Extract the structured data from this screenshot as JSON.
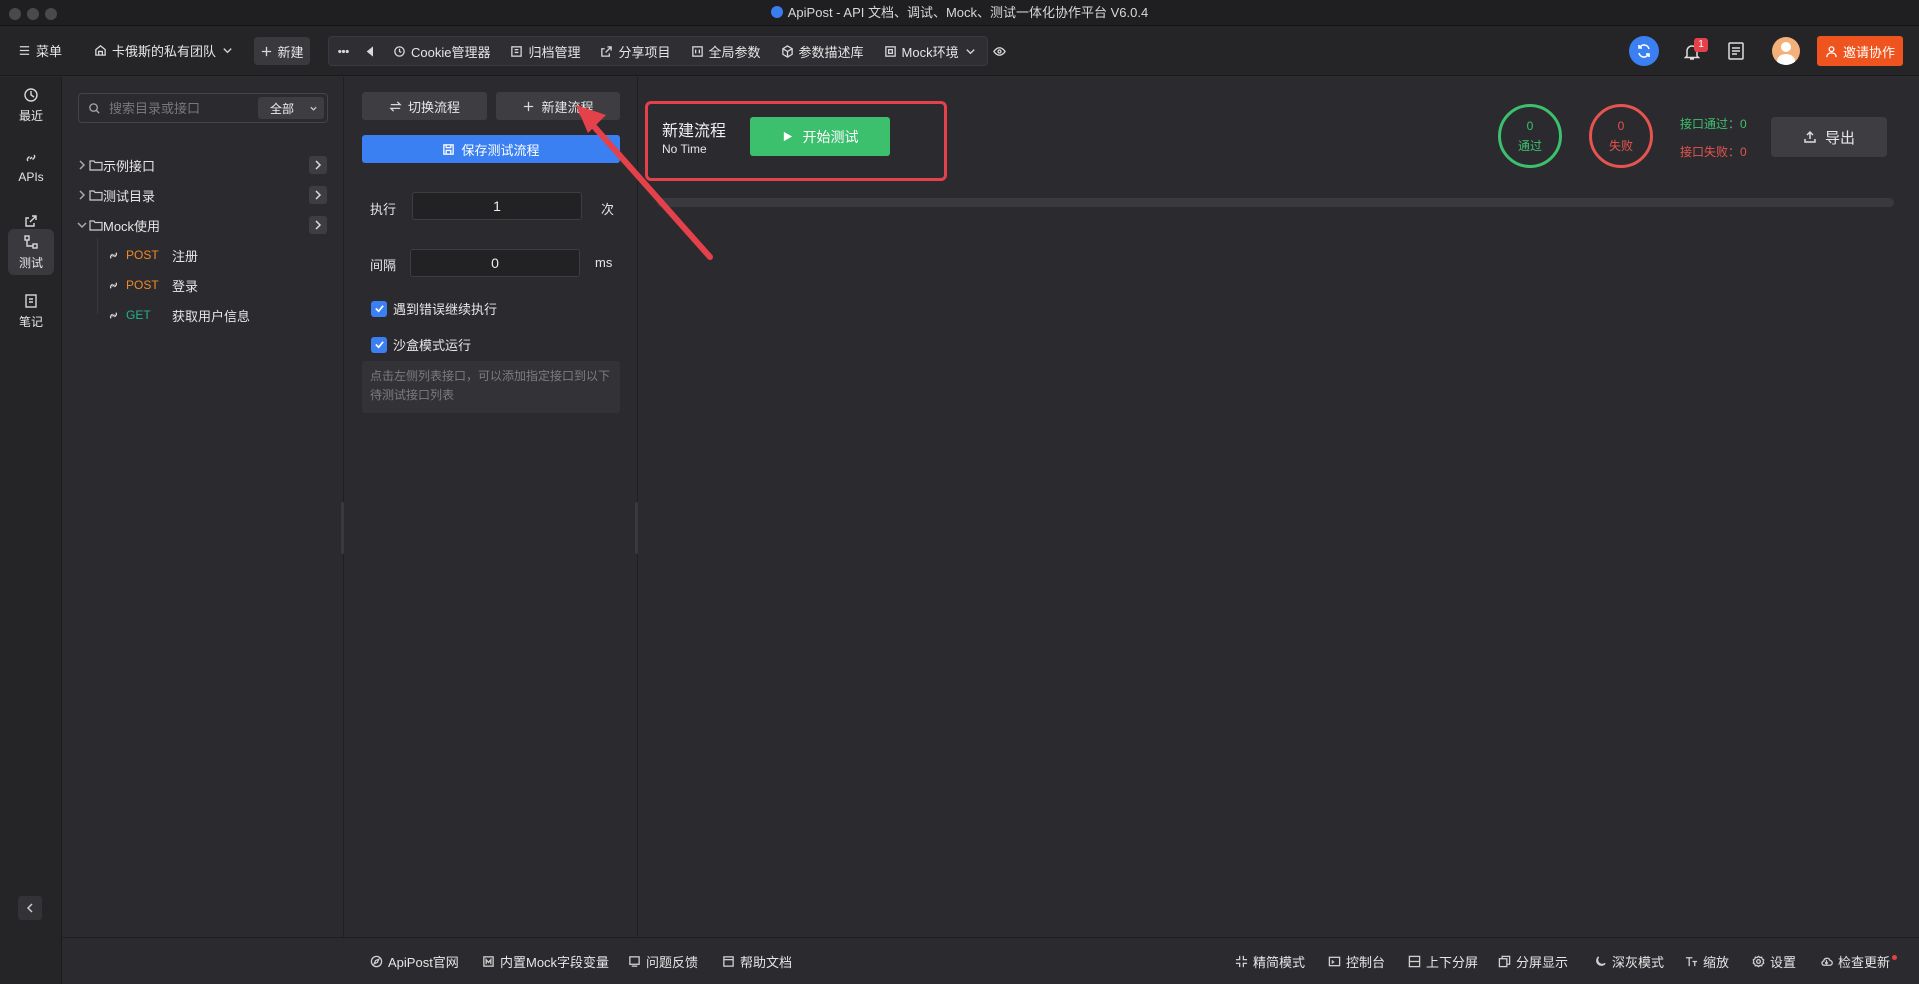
{
  "window": {
    "title": "ApiPost - API 文档、调试、Mock、测试一体化协作平台 V6.0.4"
  },
  "topbar": {
    "menu_label": "菜单",
    "team_name": "卡俄斯的私有团队",
    "new_label": "新建",
    "tools": [
      {
        "label": "Cookie管理器",
        "icon": "cookie-icon"
      },
      {
        "label": "归档管理",
        "icon": "archive-icon"
      },
      {
        "label": "分享项目",
        "icon": "share-icon"
      },
      {
        "label": "全局参数",
        "icon": "params-icon"
      },
      {
        "label": "参数描述库",
        "icon": "cube-icon"
      },
      {
        "label": "Mock环境",
        "icon": "mock-icon"
      }
    ],
    "notification_count": "1",
    "invite_label": "邀请协作"
  },
  "rail": {
    "items": [
      {
        "label": "最近",
        "icon": "clock-icon"
      },
      {
        "label": "APIs",
        "icon": "link-icon"
      },
      {
        "label": "分享",
        "icon": "share-icon"
      },
      {
        "label": "测试",
        "icon": "flow-icon"
      },
      {
        "label": "笔记",
        "icon": "note-icon"
      }
    ]
  },
  "tree": {
    "search_placeholder": "搜索目录或接口",
    "filter_value": "全部",
    "folders": [
      {
        "name": "示例接口"
      },
      {
        "name": "测试目录"
      },
      {
        "name": "Mock使用"
      }
    ],
    "apis": [
      {
        "method": "POST",
        "name": "注册"
      },
      {
        "method": "POST",
        "name": "登录"
      },
      {
        "method": "GET",
        "name": "获取用户信息"
      }
    ]
  },
  "config": {
    "switch_flow_label": "切换流程",
    "new_flow_label": "新建流程",
    "save_flow_label": "保存测试流程",
    "exec_label": "执行",
    "exec_value": "1",
    "exec_unit": "次",
    "interval_label": "间隔",
    "interval_value": "0",
    "interval_unit": "ms",
    "continue_on_error_label": "遇到错误继续执行",
    "continue_on_error": true,
    "sandbox_label": "沙盒模式运行",
    "sandbox": true,
    "hint": "点击左侧列表接口，可以添加指定接口到以下待测试接口列表"
  },
  "main": {
    "flow_name": "新建流程",
    "flow_time": "No Time",
    "start_label": "开始测试",
    "pass_count": "0",
    "pass_label": "通过",
    "fail_count": "0",
    "fail_label": "失败",
    "api_pass_text": "接口通过：0",
    "api_fail_text": "接口失败：0",
    "export_label": "导出",
    "progress": 0,
    "colors": {
      "pass": "#3cc06e",
      "fail": "#e5544f",
      "accent": "#3a80f2",
      "invite": "#f0541e"
    }
  },
  "statusbar": {
    "left": [
      {
        "label": "ApiPost官网",
        "icon": "compass-icon"
      },
      {
        "label": "内置Mock字段变量",
        "icon": "mock-icon"
      },
      {
        "label": "问题反馈",
        "icon": "feedback-icon"
      },
      {
        "label": "帮助文档",
        "icon": "doc-icon"
      }
    ],
    "right": [
      {
        "label": "精简模式",
        "icon": "compress-icon"
      },
      {
        "label": "控制台",
        "icon": "console-icon"
      },
      {
        "label": "上下分屏",
        "icon": "split-icon"
      },
      {
        "label": "分屏显示",
        "icon": "copy-icon"
      },
      {
        "label": "深灰模式",
        "icon": "moon-icon"
      },
      {
        "label": "缩放",
        "icon": "font-size-icon"
      },
      {
        "label": "设置",
        "icon": "gear-icon"
      },
      {
        "label": "检查更新",
        "icon": "cloud-icon"
      }
    ]
  }
}
